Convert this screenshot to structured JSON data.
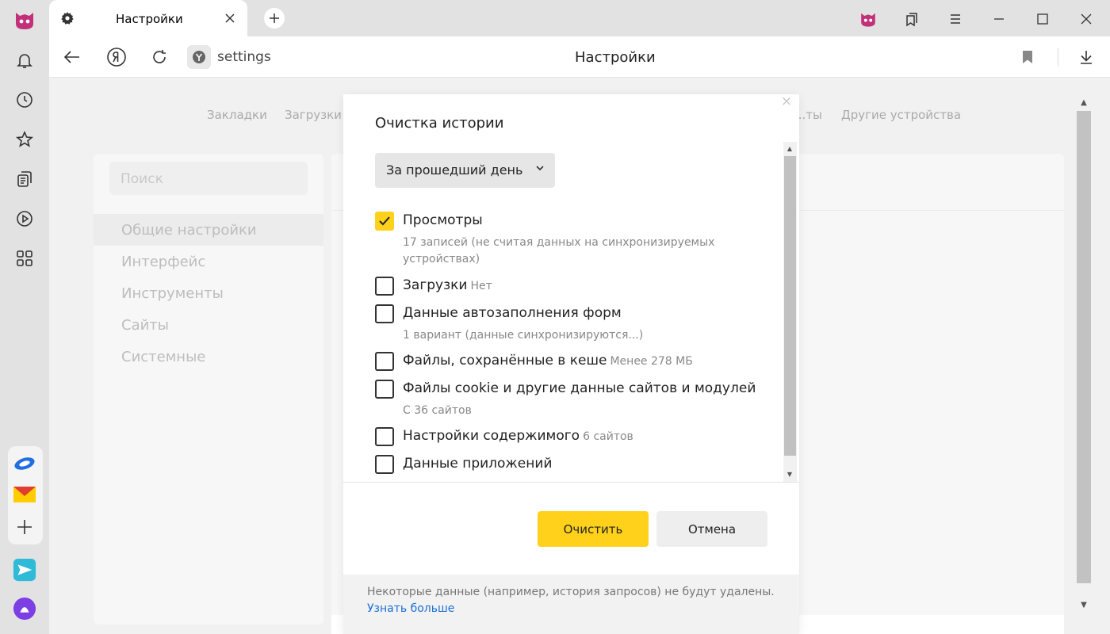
{
  "tab": {
    "title": "Настройки"
  },
  "address": {
    "url": "settings",
    "page_title": "Настройки"
  },
  "topnav": [
    "Закладки",
    "Загрузки",
    "...ты",
    "Другие устройства"
  ],
  "sidebar_menu": {
    "search_placeholder": "Поиск",
    "items": [
      "Общие настройки",
      "Интерфейс",
      "Инструменты",
      "Сайты",
      "Системные"
    ]
  },
  "dialog": {
    "title": "Очистка истории",
    "close_glyph": "×",
    "period": "За прошедший день",
    "options": [
      {
        "label": "Просмотры",
        "checked": true,
        "detail": "17 записей (не считая данных на синхронизируемых устройствах)"
      },
      {
        "label": "Загрузки",
        "checked": false,
        "inline_note": "Нет"
      },
      {
        "label": "Данные автозаполнения форм",
        "checked": false,
        "detail": "1 вариант (данные синхронизируются...)"
      },
      {
        "label": "Файлы, сохранённые в кеше",
        "checked": false,
        "inline_note": "Менее 278 МБ"
      },
      {
        "label": "Файлы cookie и другие данные сайтов и модулей",
        "checked": false,
        "detail": "С 36 сайтов"
      },
      {
        "label": "Настройки содержимого",
        "checked": false,
        "inline_note": "6 сайтов"
      },
      {
        "label": "Данные приложений",
        "checked": false
      }
    ],
    "clear_label": "Очистить",
    "cancel_label": "Отмена",
    "footer_text": "Некоторые данные (например, история запросов) не будут удалены.",
    "footer_link": "Узнать больше"
  },
  "colors": {
    "accent_yellow": "#ffd11a",
    "link_blue": "#1a6fd4"
  }
}
